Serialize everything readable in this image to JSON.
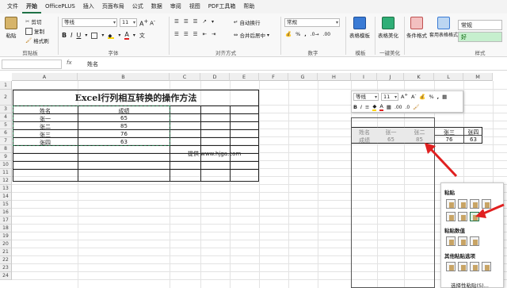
{
  "menu": [
    "文件",
    "开始",
    "OfficePLUS",
    "插入",
    "页面布局",
    "公式",
    "数据",
    "审阅",
    "视图",
    "PDF工具箱",
    "帮助"
  ],
  "active_menu": "开始",
  "ribbon": {
    "paste_label": "粘贴",
    "cut_label": "剪切",
    "copy_label": "复制",
    "painter_label": "格式刷",
    "clipboard_group": "剪贴板",
    "font_name": "等线",
    "font_size": "11",
    "font_group": "字体",
    "align_group": "对齐方式",
    "wrap_label": "自动换行",
    "merge_label": "合并后居中",
    "number_format": "常规",
    "number_group": "数字",
    "template_label": "表格模板",
    "template_group": "模板",
    "beautify_label": "表格美化",
    "beautify_group": "一键美化",
    "cond_format_label": "条件格式",
    "apply_format_label": "套用表格格式",
    "style_group": "样式",
    "style_normal": "常规",
    "style_good": "好"
  },
  "formula_bar": {
    "name_box": "",
    "fx": "fx",
    "formula": "姓名"
  },
  "columns": [
    "A",
    "B",
    "C",
    "D",
    "E",
    "F",
    "G",
    "H",
    "I",
    "J",
    "K",
    "L",
    "M"
  ],
  "rows": [
    "1",
    "2",
    "3",
    "4",
    "5",
    "6",
    "7",
    "8",
    "9",
    "10",
    "11",
    "12",
    "13",
    "14",
    "15",
    "16",
    "17",
    "18",
    "19",
    "20",
    "21",
    "22",
    "23",
    "24"
  ],
  "sheet": {
    "title": "Excel行列相互转换的操作方法",
    "header": [
      "姓名",
      "成绩"
    ],
    "data": [
      [
        "张一",
        "65"
      ],
      [
        "张二",
        "85"
      ],
      [
        "张三",
        "76"
      ],
      [
        "张四",
        "63"
      ]
    ],
    "provider": "提供 www.hjga.com"
  },
  "transposed": {
    "row1": [
      "姓名",
      "张一",
      "张二",
      "张三",
      "张四"
    ],
    "row2": [
      "成绩",
      "65",
      "85",
      "76",
      "63"
    ]
  },
  "mini_toolbar": {
    "font": "等线",
    "size": "11"
  },
  "paste_menu": {
    "paste_header": "粘贴",
    "values_header": "粘贴数值",
    "other_header": "其他粘贴选项",
    "special_label": "选择性粘贴(S)..."
  },
  "colors": {
    "accent": "#1e7145",
    "arrow": "#e02020",
    "good_bg": "#c6efce",
    "good_fg": "#006100"
  }
}
